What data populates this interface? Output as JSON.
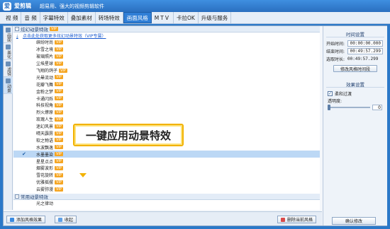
{
  "app": {
    "logo_text": "爱",
    "name": "爱剪辑",
    "slogan": "超易用、强大的视频剪辑软件"
  },
  "menu": {
    "items": [
      "视 频",
      "音 频",
      "字幕特效",
      "叠加素材",
      "转场特效",
      "画面风格",
      "MTV",
      "卡拉OK",
      "升级与服务"
    ],
    "active_index": 5
  },
  "side_tabs": [
    {
      "label": "画面"
    },
    {
      "label": "美化"
    },
    {
      "label": "滤镜"
    },
    {
      "label": "动景"
    }
  ],
  "list": {
    "group1_title": "炫幻动景特效",
    "vip_label": "VIP",
    "tip_text": "点击此处获取更多炫幻动景特效（VIP专属）",
    "effects": [
      {
        "name": "缤纷时尚",
        "vip": true
      },
      {
        "name": "冰雪之境",
        "vip": true
      },
      {
        "name": "玻璃照片",
        "vip": true
      },
      {
        "name": "尘埃星球",
        "vip": true
      },
      {
        "name": "飞翔的鸽子",
        "vip": true
      },
      {
        "name": "光晕流动",
        "vip": true
      },
      {
        "name": "花瓣飞舞",
        "vip": true
      },
      {
        "name": "金粉之梦",
        "vip": true
      },
      {
        "name": "卡通闪烁",
        "vip": true
      },
      {
        "name": "科技视角",
        "vip": true
      },
      {
        "name": "烈火燎原",
        "vip": true
      },
      {
        "name": "玫瑰人生",
        "vip": true
      },
      {
        "name": "迷幻风景",
        "vip": true
      },
      {
        "name": "晴天霹雳",
        "vip": true
      },
      {
        "name": "软之物语",
        "vip": true
      },
      {
        "name": "水波飘逸",
        "vip": true
      },
      {
        "name": "水墨墨染",
        "vip": true,
        "selected": true
      },
      {
        "name": "星星点点",
        "vip": true
      },
      {
        "name": "烟雾波形",
        "vip": true
      },
      {
        "name": "雪花旋转",
        "vip": true
      },
      {
        "name": "优雅摇摆",
        "vip": true
      },
      {
        "name": "云雾弥漫",
        "vip": true
      }
    ],
    "group2_title": "常用动景特效",
    "group2_effects": [
      {
        "name": "光之律动"
      }
    ]
  },
  "callout": {
    "text": "一键应用动景特效"
  },
  "right_panel": {
    "time_section_title": "时间设置",
    "start_label": "开始时间:",
    "start_value": "00:00:00.000",
    "end_label": "结束时间:",
    "end_value": "00:49:57.299",
    "duration_label": "选取时长:",
    "duration_value": "00:49:57.299",
    "modify_time_button": "修改风格时间段",
    "effect_section_title": "效果设置",
    "soft_transition_label": "柔和过渡",
    "soft_transition_checked": true,
    "opacity_label": "透明度:",
    "opacity_value": "0",
    "confirm_button": "确认修改"
  },
  "bottom_bar": {
    "add_button": "添加风格效果",
    "collapse_button": "收起",
    "delete_button": "删除当前风格"
  },
  "colors": {
    "accent": "#2f7ed6",
    "title_bar": "#2a6fc0",
    "callout_border": "#f2b200",
    "vip_badge": "#f5a623",
    "selected_row": "#bcd8f5"
  }
}
